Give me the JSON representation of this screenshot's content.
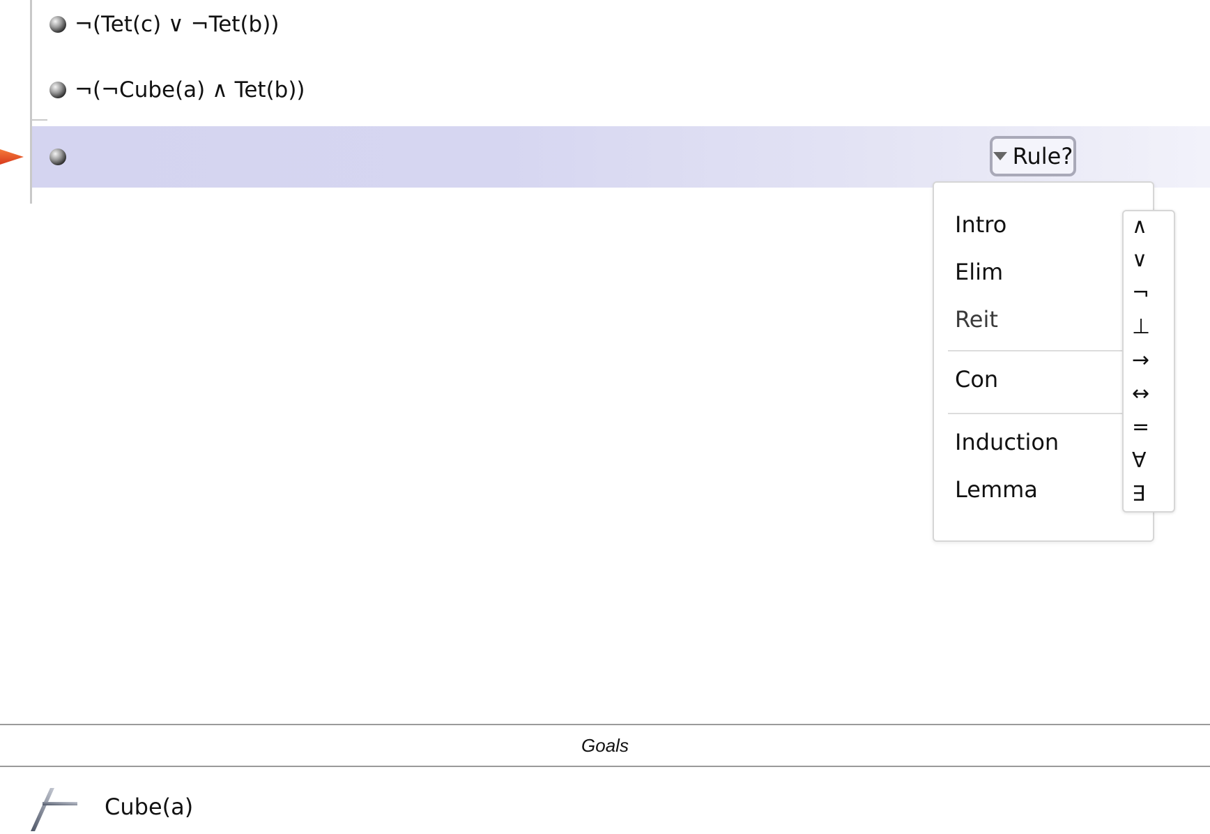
{
  "proof": {
    "premises": [
      {
        "sentence": "¬(Tet(c) ∨ ¬Tet(b))"
      },
      {
        "sentence": "¬(¬Cube(a) ∧ Tet(b))"
      }
    ],
    "current_step": {
      "sentence": "",
      "rule_button_label": "Rule?"
    }
  },
  "rule_menu": {
    "groups": [
      [
        "Intro",
        "Elim",
        "Reit"
      ],
      [
        "Con"
      ],
      [
        "Induction",
        "Lemma"
      ]
    ],
    "connectives": [
      "∧",
      "∨",
      "¬",
      "⊥",
      "→",
      "↔",
      "=",
      "∀",
      "∃"
    ]
  },
  "goals": {
    "title": "Goals",
    "items": [
      {
        "icon": "turnstile-icon",
        "sentence": "Cube(a)"
      }
    ]
  },
  "colors": {
    "current_step_bg": "#d4d4f0",
    "focus_arrow": "#e8502a",
    "rule_button_border": "#a9a9b8"
  }
}
